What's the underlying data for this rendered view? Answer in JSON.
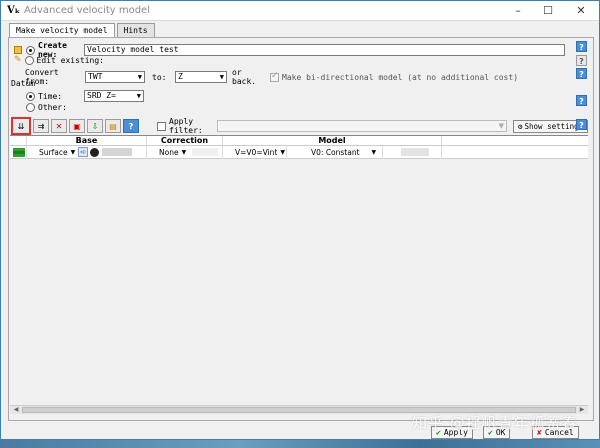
{
  "window": {
    "title": "Advanced velocity model",
    "minimize_glyph": "–",
    "maximize_glyph": "☐",
    "close_glyph": "✕"
  },
  "tabs": [
    {
      "label": "Make velocity model",
      "active": true
    },
    {
      "label": "Hints",
      "active": false
    }
  ],
  "create_new": {
    "label": "Create new:",
    "value": "Velocity model test",
    "selected": true
  },
  "edit_existing": {
    "label": "Edit existing:",
    "selected": false
  },
  "convert": {
    "from_label": "Convert from:",
    "from_value": "TWT",
    "to_label": "to:",
    "to_value": "Z",
    "or_back_label": "or back.",
    "bidirectional_label": "Make bi-directional model (at no additional cost)",
    "bidirectional_checked": true
  },
  "datum": {
    "group_label": "Datum",
    "time_label": "Time:",
    "time_value": "SRD Z=",
    "time_selected": true,
    "other_label": "Other:",
    "other_selected": false
  },
  "toolbar": {
    "buttons": [
      "append-row",
      "insert-row",
      "delete-row",
      "delete-all",
      "import-settings",
      "export-settings"
    ],
    "help_glyph": "?",
    "apply_filter_label": "Apply filter:",
    "show_settings_label": "Show settings"
  },
  "grid": {
    "headers": {
      "base": "Base",
      "correction": "Correction",
      "model": "Model"
    },
    "rows": [
      {
        "base_type": "Surface",
        "correction": "None",
        "model_formula": "V=V0=Vint",
        "model_v0": "V0: Constant"
      }
    ]
  },
  "footer": {
    "apply_label": "Apply",
    "ok_label": "OK",
    "cancel_label": "Cancel",
    "watermark": "知乎 @揺帆青年孤篝舂"
  },
  "colors": {
    "accent": "#4a8fd6",
    "highlight": "#e03030",
    "surface_flag": "#2fa02f"
  }
}
